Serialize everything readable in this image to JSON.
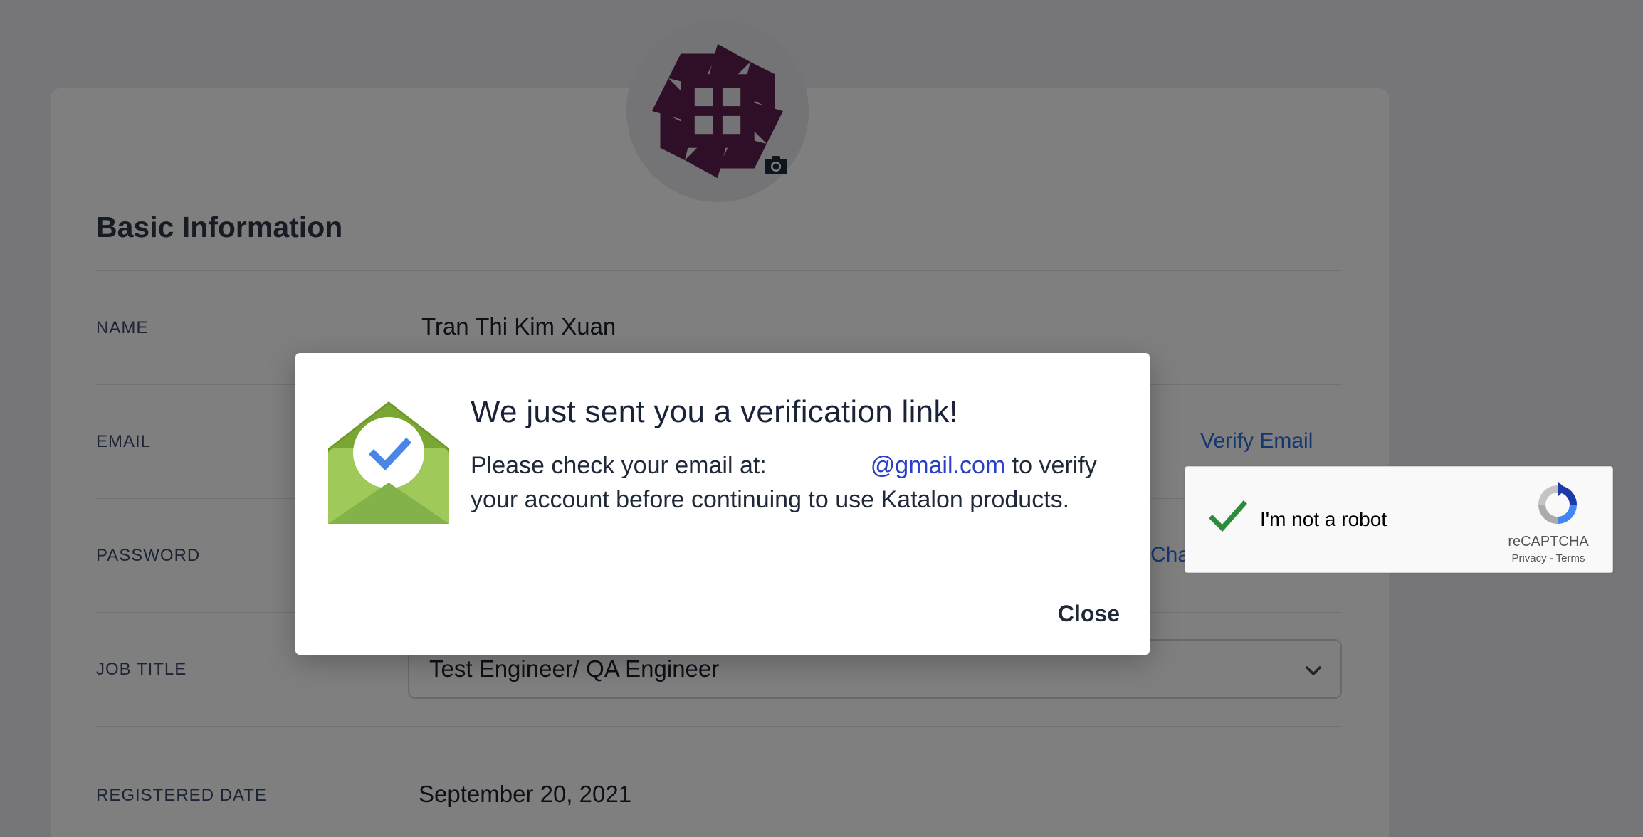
{
  "profile": {
    "section_title": "Basic Information",
    "avatar_icon": "katalon-avatar-logo",
    "camera_icon": "camera-icon",
    "rows": {
      "name": {
        "label": "NAME",
        "value": "Tran Thi Kim Xuan"
      },
      "email": {
        "label": "EMAIL",
        "action": "Verify Email"
      },
      "password": {
        "label": "PASSWORD",
        "action_partial": "Cha"
      },
      "job_title": {
        "label": "JOB TITLE",
        "value": "Test Engineer/ QA Engineer"
      },
      "registered_date": {
        "label": "REGISTERED DATE",
        "value": "September 20, 2021"
      }
    }
  },
  "recaptcha": {
    "label": "I'm not a robot",
    "brand": "reCAPTCHA",
    "links": "Privacy - Terms",
    "checked": true
  },
  "modal": {
    "title": "We just sent you a verification link!",
    "message_prefix": "Please check your email at:",
    "email_domain": "@gmail.com",
    "message_suffix": "to verify your account before continuing to use Katalon products.",
    "close_label": "Close",
    "icon": "envelope-check-icon"
  },
  "colors": {
    "link": "#2d6cdf",
    "email_link": "#2b3fc7",
    "avatar": "#5c1f4e",
    "envelope_green": "#8bbe45",
    "check_blue": "#4a86e8"
  }
}
